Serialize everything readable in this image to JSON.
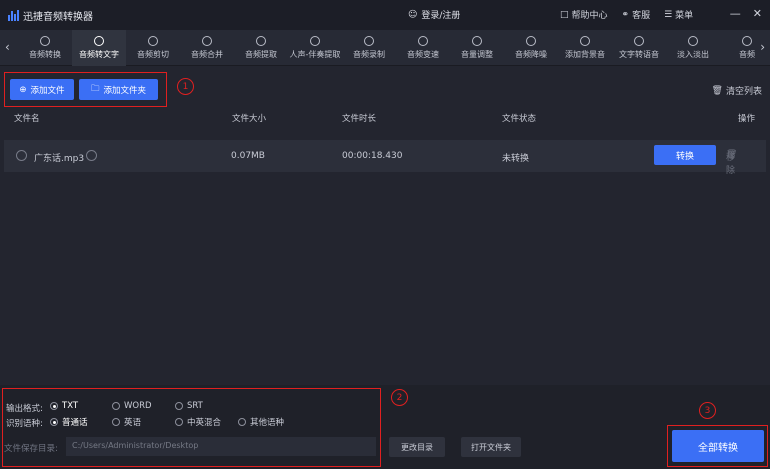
{
  "app": {
    "title": "迅捷音频转换器",
    "user_label": "登录/注册"
  },
  "titlebar": {
    "help": "帮助中心",
    "service": "客服",
    "menu": "菜单"
  },
  "toolbar": {
    "tools": [
      {
        "label": "音频转换",
        "icon": "convert-icon"
      },
      {
        "label": "音频转文字",
        "icon": "audio-text-icon"
      },
      {
        "label": "音频剪切",
        "icon": "scissors-icon"
      },
      {
        "label": "音频合并",
        "icon": "merge-icon"
      },
      {
        "label": "音频提取",
        "icon": "extract-icon"
      },
      {
        "label": "人声-伴奏提取",
        "icon": "vocal-icon"
      },
      {
        "label": "音频录制",
        "icon": "mic-icon"
      },
      {
        "label": "音频变速",
        "icon": "speed-icon"
      },
      {
        "label": "音量调整",
        "icon": "volume-icon"
      },
      {
        "label": "音频降噪",
        "icon": "noise-icon"
      },
      {
        "label": "添加背景音",
        "icon": "bg-music-icon"
      },
      {
        "label": "文字转语音",
        "icon": "tts-icon"
      },
      {
        "label": "淡入淡出",
        "icon": "fade-icon"
      },
      {
        "label": "音频",
        "icon": "more-icon"
      }
    ]
  },
  "actions": {
    "add_file": "添加文件",
    "add_folder": "添加文件夹",
    "clear_list": "清空列表"
  },
  "annotations": {
    "one": "1",
    "two": "2",
    "three": "3"
  },
  "table": {
    "headers": {
      "name": "文件名",
      "size": "文件大小",
      "duration": "文件时长",
      "status": "文件状态",
      "op": "操作"
    },
    "rows": [
      {
        "name": "广东话.mp3",
        "size": "0.07MB",
        "duration": "00:00:18.430",
        "status": "未转换",
        "convert": "转换",
        "remove": "移除"
      }
    ]
  },
  "output": {
    "format_label": "输出格式:",
    "formats": [
      "TXT",
      "WORD",
      "SRT"
    ],
    "selected_format": "TXT",
    "lang_label": "识别语种:",
    "languages": [
      "普通话",
      "英语",
      "中英混合",
      "其他语种"
    ],
    "selected_language": "普通话",
    "save_label": "文件保存目录:",
    "save_path": "C:/Users/Administrator/Desktop",
    "change_dir": "更改目录",
    "open_folder": "打开文件夹",
    "convert_all": "全部转换"
  },
  "colors": {
    "accent": "#3b6ff5",
    "annotation": "#e02020",
    "background": "#23252f"
  }
}
